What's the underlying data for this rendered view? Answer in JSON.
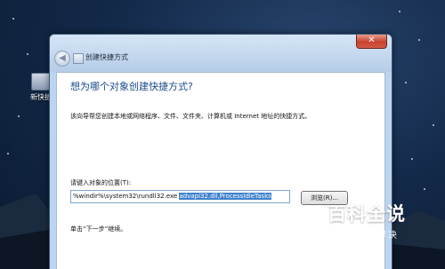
{
  "desktop": {
    "icon_label": "新快捷"
  },
  "window": {
    "title": "创建快捷方式",
    "close_glyph": "✕",
    "back_glyph": "◀",
    "heading": "想为哪个对象创建快捷方式?",
    "description": "该向导帮您创建本地或网络程序、文件、文件夹、计算机或 Internet 地址的快捷方式。",
    "location_label": "请键入对象的位置(T):",
    "location_prefix": "%windir%\\system32\\rundll32.exe ",
    "location_selected": "advapi32.dll,ProcessIdleTasks",
    "browse_label": "浏览(R)...",
    "next_hint": "单击“下一步”继续。"
  },
  "watermark": {
    "main": "百科全说",
    "sub": "助你轻松解决"
  },
  "colors": {
    "heading": "#1b4b8c",
    "selection": "#3f82cc",
    "close_button": "#c7422d"
  }
}
